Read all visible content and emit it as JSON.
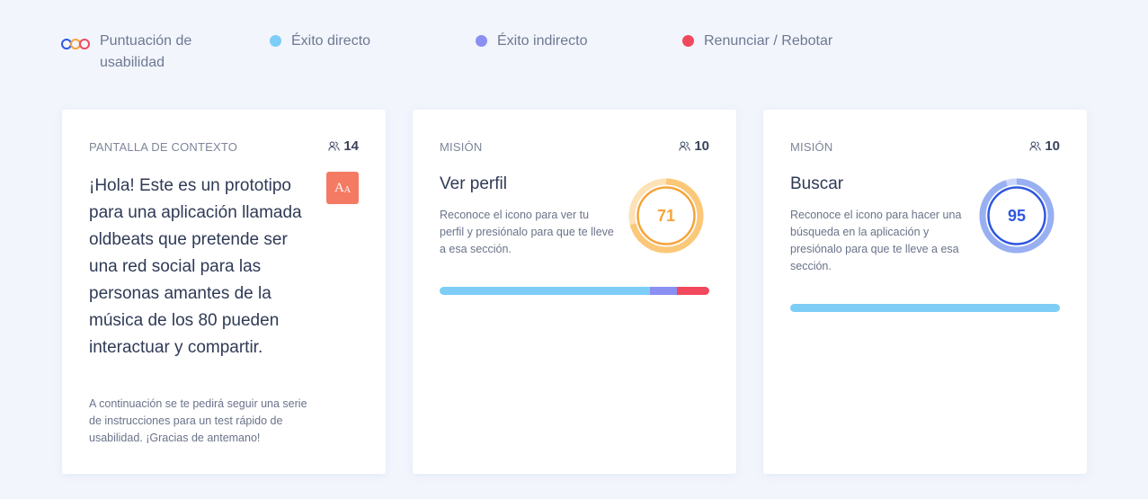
{
  "colors": {
    "direct": "#7dcdf7",
    "indirect": "#8b8ff2",
    "bounce": "#f2485c",
    "score_orange": "#f5a43c",
    "score_blue": "#2f57e0",
    "context_icon": "#f47a63"
  },
  "legend": {
    "logo_icon": "usability-logo-icon",
    "score_label": "Puntuación de usabilidad",
    "direct_label": "Éxito directo",
    "indirect_label": "Éxito indirecto",
    "bounce_label": "Renunciar / Rebotar"
  },
  "cards": [
    {
      "kicker": "PANTALLA DE CONTEXTO",
      "count": "14",
      "title": "¡Hola! Este es un prototipo para una aplicación llamada oldbeats que pretende ser una red social para las personas amantes de la música de los 80 pueden interactuar y compartir.",
      "icon": "text-size-icon",
      "icon_big": "A",
      "icon_small": "A",
      "description": "A continuación se te pedirá seguir una serie de instrucciones para un test rápido de usabilidad. ¡Gracias de antemano!"
    },
    {
      "kicker": "MISIÓN",
      "count": "10",
      "title": "Ver perfil",
      "description": "Reconoce el icono para ver tu perfil y presiónalo para que te lleve a esa sección.",
      "score": "71",
      "score_fraction": 0.71,
      "breakdown": {
        "direct": 0.78,
        "indirect": 0.1,
        "bounce": 0.12
      }
    },
    {
      "kicker": "MISIÓN",
      "count": "10",
      "title": "Buscar",
      "description": "Reconoce el icono para hacer una búsqueda en la aplicación y presiónalo para que te lleve a esa sección.",
      "score": "95",
      "score_fraction": 0.95,
      "breakdown": {
        "direct": 1.0,
        "indirect": 0.0,
        "bounce": 0.0
      }
    }
  ]
}
